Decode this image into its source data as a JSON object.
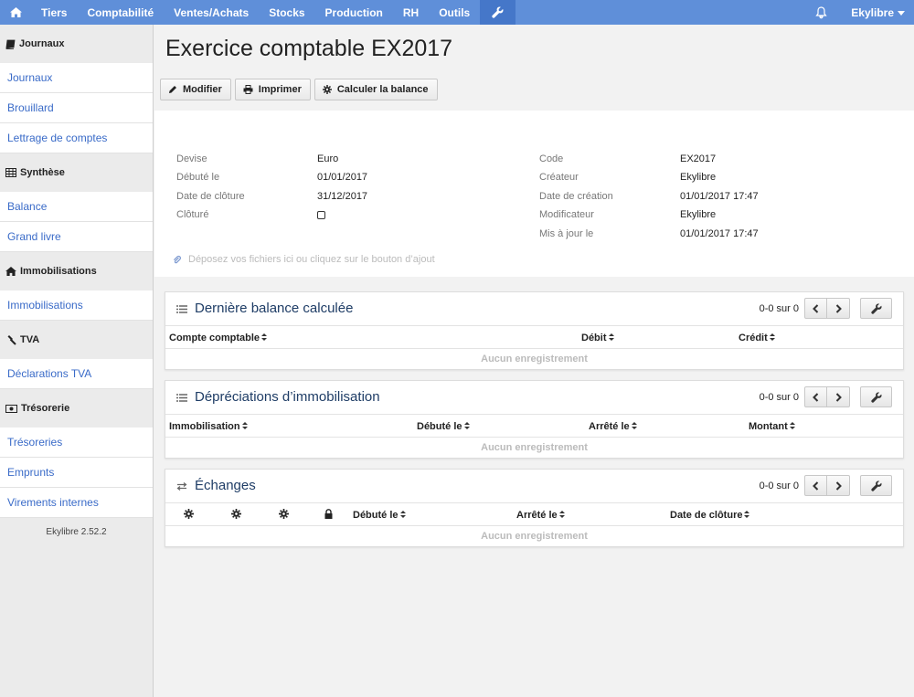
{
  "nav": {
    "items": [
      "Tiers",
      "Comptabilité",
      "Ventes/Achats",
      "Stocks",
      "Production",
      "RH",
      "Outils"
    ],
    "user": "Ekylibre"
  },
  "sidebar": {
    "sections": [
      {
        "title": "Journaux",
        "icon": "book-icon",
        "links": [
          "Journaux",
          "Brouillard",
          "Lettrage de comptes"
        ]
      },
      {
        "title": "Synthèse",
        "icon": "table-icon",
        "links": [
          "Balance",
          "Grand livre"
        ]
      },
      {
        "title": "Immobilisations",
        "icon": "home-icon",
        "links": [
          "Immobilisations"
        ]
      },
      {
        "title": "TVA",
        "icon": "gavel-icon",
        "links": [
          "Déclarations TVA"
        ]
      },
      {
        "title": "Trésorerie",
        "icon": "money-icon",
        "links": [
          "Trésoreries",
          "Emprunts",
          "Virements internes"
        ]
      }
    ],
    "version": "Ekylibre 2.52.2"
  },
  "page": {
    "title": "Exercice comptable EX2017",
    "buttons": {
      "edit": "Modifier",
      "print": "Imprimer",
      "balance": "Calculer la balance"
    }
  },
  "details": {
    "left": [
      {
        "label": "Devise",
        "value": "Euro"
      },
      {
        "label": "Débuté le",
        "value": "01/01/2017"
      },
      {
        "label": "Date de clôture",
        "value": "31/12/2017"
      },
      {
        "label": "Clôturé",
        "value": ""
      }
    ],
    "right": [
      {
        "label": "Code",
        "value": "EX2017"
      },
      {
        "label": "Créateur",
        "value": "Ekylibre"
      },
      {
        "label": "Date de création",
        "value": "01/01/2017 17:47"
      },
      {
        "label": "Modificateur",
        "value": "Ekylibre"
      },
      {
        "label": "Mis à jour le",
        "value": "01/01/2017 17:47"
      }
    ]
  },
  "dropzone": {
    "text": "Déposez vos fichiers ici ou cliquez sur le bouton d’ajout"
  },
  "panels": [
    {
      "title": "Dernière balance calculée",
      "pager": "0-0 sur 0",
      "columns": [
        "Compte comptable",
        "Débit",
        "Crédit"
      ],
      "empty": "Aucun enregistrement"
    },
    {
      "title": "Dépréciations d’immobilisation",
      "pager": "0-0 sur 0",
      "columns": [
        "Immobilisation",
        "Débuté le",
        "Arrêté le",
        "Montant"
      ],
      "empty": "Aucun enregistrement"
    },
    {
      "title": "Échanges",
      "pager": "0-0 sur 0",
      "columns": [
        "Débuté le",
        "Arrêté le",
        "Date de clôture"
      ],
      "empty": "Aucun enregistrement"
    }
  ]
}
